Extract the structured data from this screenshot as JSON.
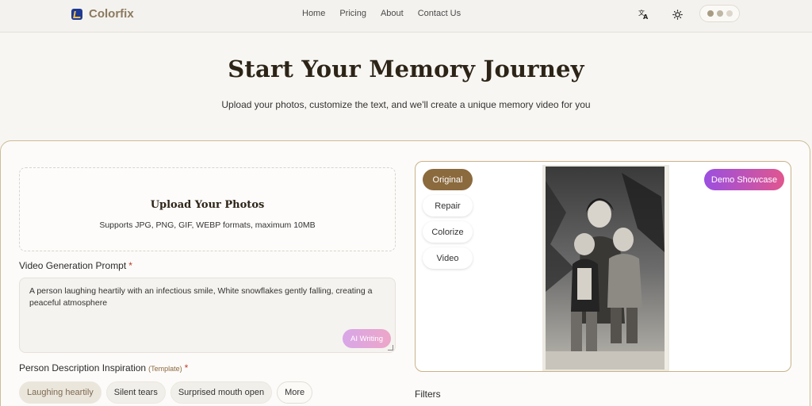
{
  "nav": {
    "brand": "Colorfix",
    "links": [
      "Home",
      "Pricing",
      "About",
      "Contact Us"
    ]
  },
  "hero": {
    "title": "Start Your Memory Journey",
    "subtitle": "Upload your photos, customize the text, and we'll create a unique memory video for you"
  },
  "upload": {
    "title": "Upload Your Photos",
    "subtitle": "Supports JPG, PNG, GIF, WEBP formats, maximum 10MB"
  },
  "prompt": {
    "label": "Video Generation Prompt",
    "required_mark": "*",
    "text": "A person laughing heartily with an infectious smile,  White snowflakes gently falling, creating a peaceful atmosphere",
    "ai_button": "AI Writing"
  },
  "inspiration": {
    "label": "Person Description Inspiration",
    "template_note": "(Template)",
    "required_mark": "*",
    "chips": [
      "Laughing heartily",
      "Silent tears",
      "Surprised mouth open",
      "More"
    ]
  },
  "preview": {
    "modes": [
      "Original",
      "Repair",
      "Colorize",
      "Video"
    ],
    "active_mode": "Original",
    "demo_button": "Demo Showcase"
  },
  "filters": {
    "label": "Filters"
  },
  "colors": {
    "accent": "#8b6a3e",
    "demo_gradient_start": "#9b4fe0",
    "demo_gradient_end": "#e0568f",
    "ai_gradient_start": "#d8a6e8",
    "ai_gradient_end": "#eda6c8"
  },
  "icons": {
    "translate": "translate-icon",
    "theme": "sun-icon",
    "logo": "colorfix-logo-icon"
  }
}
